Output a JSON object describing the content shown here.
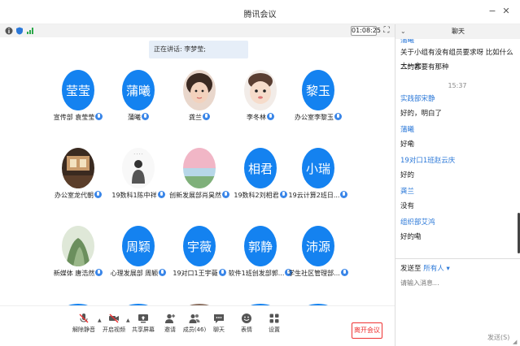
{
  "window": {
    "title": "腾讯会议"
  },
  "infobar": {
    "timer": "01:08:25"
  },
  "speaking": "正在讲话: 李梦莹;",
  "tiles": [
    {
      "label": "宣传部 袁莹莹",
      "avatar_text": "莹莹",
      "type": "text"
    },
    {
      "label": "蒲曦",
      "avatar_text": "蒲曦",
      "type": "text"
    },
    {
      "label": "龚兰",
      "avatar_text": "",
      "type": "photo-girl"
    },
    {
      "label": "李冬林",
      "avatar_text": "",
      "type": "photo-child"
    },
    {
      "label": "办公室李黎玉",
      "avatar_text": "黎玉",
      "type": "text"
    },
    {
      "label": "办公室龙代朝",
      "avatar_text": "",
      "type": "photo-room"
    },
    {
      "label": "19数科1陈中祥",
      "avatar_text": "",
      "type": "photo-figure"
    },
    {
      "label": "创新发展部肖昊然",
      "avatar_text": "",
      "type": "photo-landscape"
    },
    {
      "label": "19数科2刘相君",
      "avatar_text": "相君",
      "type": "text"
    },
    {
      "label": "19云计算2班日...",
      "avatar_text": "小瑞",
      "type": "text"
    },
    {
      "label": "新媒体 唐浩然",
      "avatar_text": "",
      "type": "photo-nature"
    },
    {
      "label": "心理发展部 周颖",
      "avatar_text": "周颖",
      "type": "text"
    },
    {
      "label": "19对口1王宇薇",
      "avatar_text": "宇薇",
      "type": "text"
    },
    {
      "label": "软件1班创发部郭...",
      "avatar_text": "郭静",
      "type": "text"
    },
    {
      "label": "学生社区管理部...",
      "avatar_text": "沛源",
      "type": "text"
    }
  ],
  "toolbar": {
    "mute": "解除静音",
    "video": "开启视频",
    "share": "共享屏幕",
    "invite": "邀请",
    "members": "成员(46)",
    "chat": "聊天",
    "reaction": "表情",
    "settings": "设置",
    "leave": "离开会议"
  },
  "chat": {
    "title": "聊天",
    "messages": [
      {
        "kind": "name",
        "text": "蒲曦"
      },
      {
        "kind": "text",
        "text": "关于小组有没有组员要求呀 比如什么大一大"
      },
      {
        "kind": "text",
        "text": "二的都要有那种"
      },
      {
        "kind": "time",
        "text": "15:37"
      },
      {
        "kind": "name",
        "text": "实践部宋静"
      },
      {
        "kind": "text",
        "text": "好的，明白了"
      },
      {
        "kind": "name",
        "text": "蒲曦"
      },
      {
        "kind": "text",
        "text": "好嘞"
      },
      {
        "kind": "name",
        "text": "19对口1班赵云庆"
      },
      {
        "kind": "text",
        "text": "好的"
      },
      {
        "kind": "name",
        "text": "龚兰"
      },
      {
        "kind": "text",
        "text": "没有"
      },
      {
        "kind": "name",
        "text": "组织部艾鸿"
      },
      {
        "kind": "text",
        "text": "好的嘞"
      }
    ],
    "send_to_label": "发送至",
    "send_to_target": "所有人",
    "input_placeholder": "请输入消息...",
    "send_button": "发送(S)"
  },
  "colors": {
    "accent": "#1482f0",
    "leave": "#e33333",
    "name": "#2b78d8"
  }
}
